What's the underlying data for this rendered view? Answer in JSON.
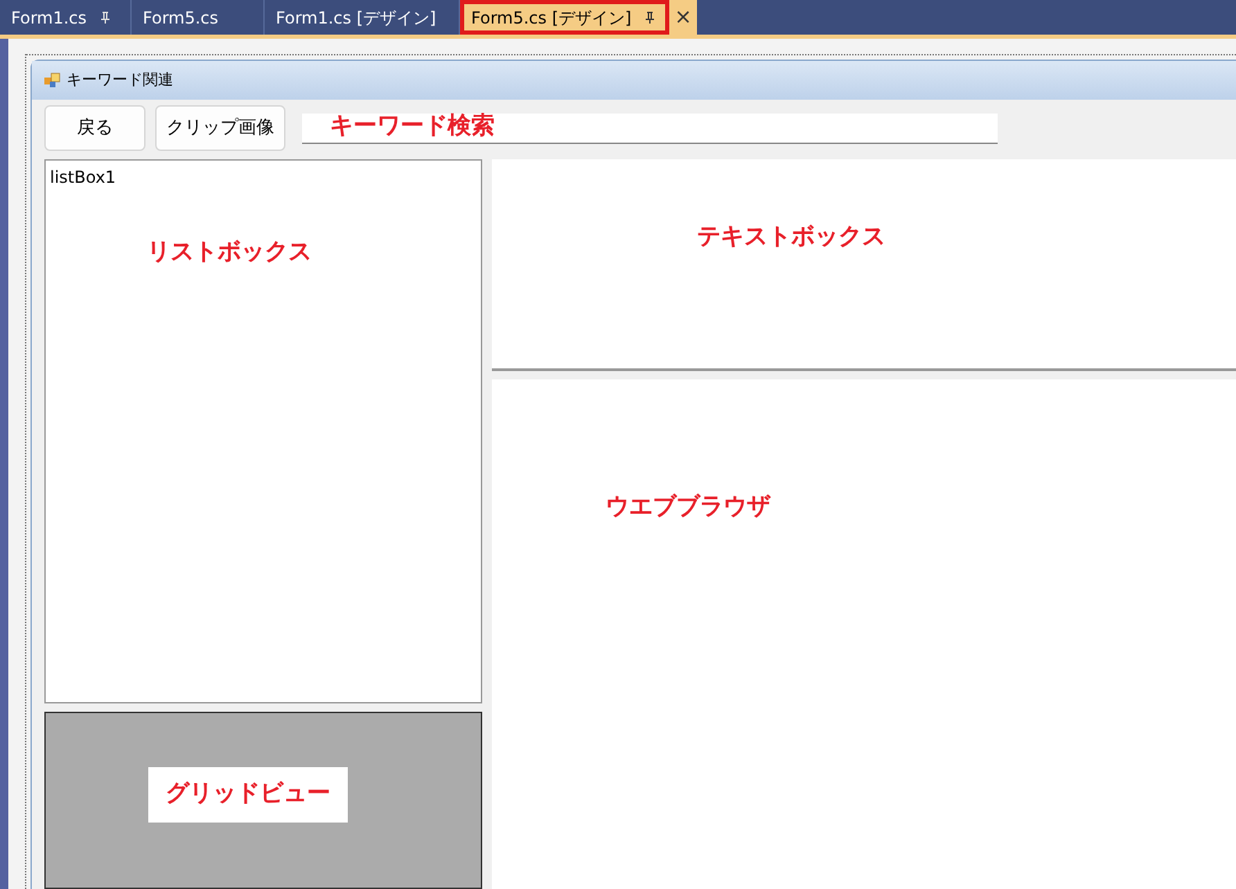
{
  "tabs": [
    {
      "label": "Form1.cs",
      "pinned": true,
      "selected": false,
      "highlighted": false
    },
    {
      "label": "Form5.cs",
      "pinned": false,
      "selected": false,
      "highlighted": false
    },
    {
      "label": "Form1.cs [デザイン]",
      "pinned": false,
      "selected": false,
      "highlighted": false
    },
    {
      "label": "Form5.cs [デザイン]",
      "pinned": true,
      "selected": true,
      "highlighted": true,
      "close": "×"
    }
  ],
  "form": {
    "title": "キーワード関連",
    "buttons": [
      "戻る",
      "クリップ画像"
    ],
    "search_field": {
      "annotation": "キーワード検索"
    },
    "listbox": {
      "items": [
        "listBox1"
      ],
      "annotation": "リストボックス"
    },
    "textbox": {
      "annotation": "テキストボックス"
    },
    "browser": {
      "annotation": "ウエブブラウザ"
    },
    "gridview": {
      "annotation": "グリッドビュー"
    }
  }
}
